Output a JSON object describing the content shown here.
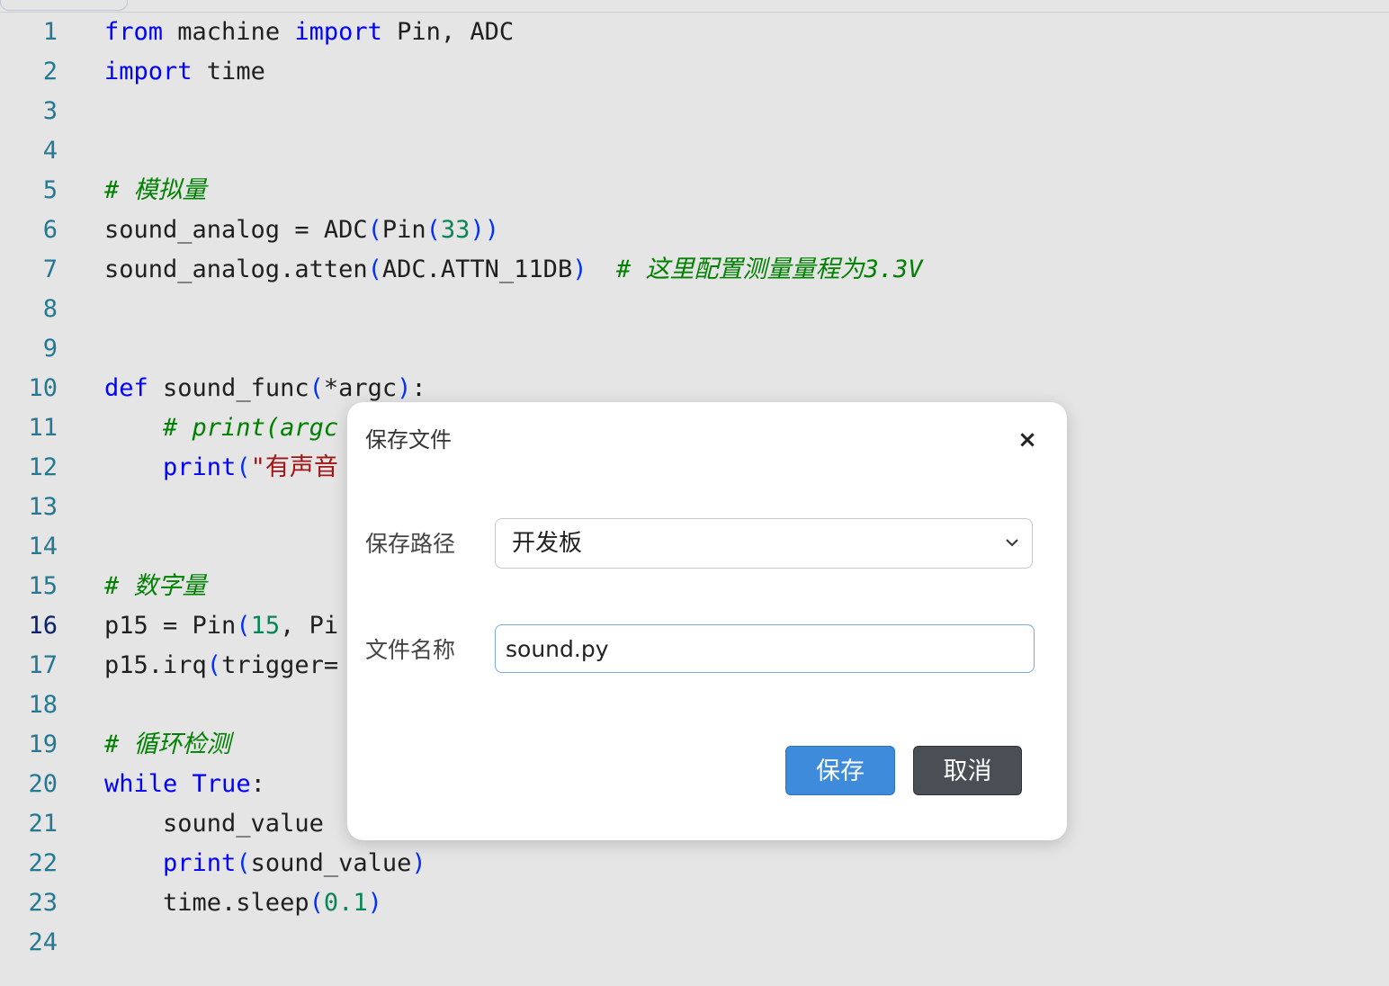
{
  "editor": {
    "line_numbers": [
      "1",
      "2",
      "3",
      "4",
      "5",
      "6",
      "7",
      "8",
      "9",
      "10",
      "11",
      "12",
      "13",
      "14",
      "15",
      "16",
      "17",
      "18",
      "19",
      "20",
      "21",
      "22",
      "23",
      "24"
    ],
    "current_line": "16",
    "lines": [
      [
        {
          "t": "from",
          "c": "kw"
        },
        {
          "t": " machine "
        },
        {
          "t": "import",
          "c": "kw"
        },
        {
          "t": " Pin, ADC"
        }
      ],
      [
        {
          "t": "import",
          "c": "kw"
        },
        {
          "t": " time"
        }
      ],
      [],
      [],
      [
        {
          "t": "# 模拟量",
          "c": "cm"
        }
      ],
      [
        {
          "t": "sound_analog = ADC"
        },
        {
          "t": "(",
          "c": "br"
        },
        {
          "t": "Pin"
        },
        {
          "t": "(",
          "c": "br"
        },
        {
          "t": "33",
          "c": "num"
        },
        {
          "t": "))",
          "c": "br"
        }
      ],
      [
        {
          "t": "sound_analog.atten"
        },
        {
          "t": "(",
          "c": "br"
        },
        {
          "t": "ADC.ATTN_11DB"
        },
        {
          "t": ")",
          "c": "br"
        },
        {
          "t": "  "
        },
        {
          "t": "# 这里配置测量量程为3.3V",
          "c": "cm"
        }
      ],
      [],
      [],
      [
        {
          "t": "def",
          "c": "kw"
        },
        {
          "t": " sound_func"
        },
        {
          "t": "(",
          "c": "br"
        },
        {
          "t": "*argc"
        },
        {
          "t": ")",
          "c": "br"
        },
        {
          "t": ":"
        }
      ],
      [
        {
          "t": "    "
        },
        {
          "t": "# print(argc",
          "c": "cm"
        }
      ],
      [
        {
          "t": "    "
        },
        {
          "t": "print",
          "c": "fn"
        },
        {
          "t": "(",
          "c": "br"
        },
        {
          "t": "\"有声音",
          "c": "str"
        }
      ],
      [],
      [],
      [
        {
          "t": "# 数字量",
          "c": "cm"
        }
      ],
      [
        {
          "t": "p15 = Pin"
        },
        {
          "t": "(",
          "c": "br"
        },
        {
          "t": "15",
          "c": "num"
        },
        {
          "t": ", Pi"
        }
      ],
      [
        {
          "t": "p15.irq"
        },
        {
          "t": "(",
          "c": "br"
        },
        {
          "t": "trigger="
        }
      ],
      [],
      [
        {
          "t": "# 循环检测",
          "c": "cm"
        }
      ],
      [
        {
          "t": "while",
          "c": "kw"
        },
        {
          "t": " "
        },
        {
          "t": "True",
          "c": "kw"
        },
        {
          "t": ":"
        }
      ],
      [
        {
          "t": "    sound_value"
        }
      ],
      [
        {
          "t": "    "
        },
        {
          "t": "print",
          "c": "fn"
        },
        {
          "t": "(",
          "c": "br"
        },
        {
          "t": "sound_value"
        },
        {
          "t": ")",
          "c": "br"
        }
      ],
      [
        {
          "t": "    time.sleep"
        },
        {
          "t": "(",
          "c": "br"
        },
        {
          "t": "0.1",
          "c": "num"
        },
        {
          "t": ")",
          "c": "br"
        }
      ],
      []
    ]
  },
  "dialog": {
    "title": "保存文件",
    "close_symbol": "×",
    "path_label": "保存路径",
    "path_selected": "开发板",
    "filename_label": "文件名称",
    "filename_value": "sound.py",
    "save_label": "保存",
    "cancel_label": "取消",
    "colors": {
      "save": "#3d8bda",
      "cancel": "#4a4f55"
    }
  }
}
